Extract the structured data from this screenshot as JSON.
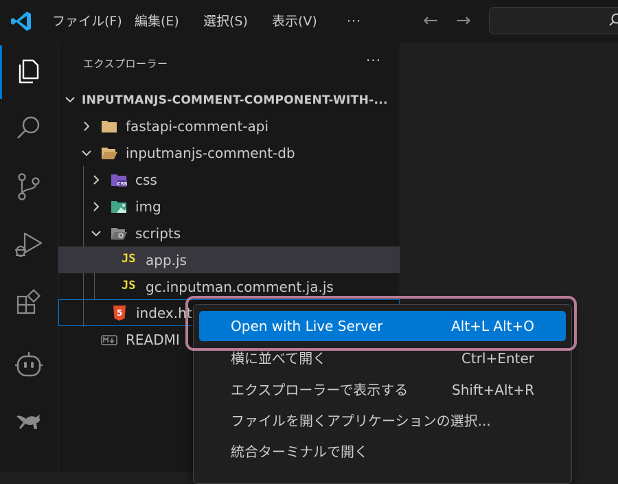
{
  "titlebar": {
    "menus": [
      "ファイル(F)",
      "編集(E)",
      "選択(S)",
      "表示(V)"
    ],
    "overflow": "···",
    "back": "←",
    "forward": "→",
    "search_placeholder": ""
  },
  "activity": {
    "icons": [
      "explorer-icon",
      "search-icon",
      "source-control-icon",
      "run-debug-icon",
      "extensions-icon",
      "copilot-icon",
      "kangaroo-icon"
    ]
  },
  "sidebar": {
    "title": "エクスプローラー",
    "more": "···",
    "root": "INPUTMANJS-COMMENT-COMPONENT-WITH-...",
    "items": [
      {
        "label": "fastapi-comment-api",
        "type": "folder",
        "expanded": false
      },
      {
        "label": "inputmanjs-comment-db",
        "type": "folder",
        "expanded": true
      },
      {
        "label": "css",
        "type": "folder-css",
        "expanded": false
      },
      {
        "label": "img",
        "type": "folder-img",
        "expanded": false
      },
      {
        "label": "scripts",
        "type": "folder-scripts",
        "expanded": true
      },
      {
        "label": "app.js",
        "type": "js",
        "badge": "JS"
      },
      {
        "label": "gc.inputman.comment.ja.js",
        "type": "js",
        "badge": "JS"
      },
      {
        "label": "index.ht",
        "type": "html"
      },
      {
        "label": "READMI",
        "type": "md"
      }
    ]
  },
  "context_menu": {
    "items": [
      {
        "label": "Open with Live Server",
        "shortcut": "Alt+L Alt+O"
      },
      {
        "label": "横に並べて開く",
        "shortcut": "Ctrl+Enter"
      },
      {
        "label": "エクスプローラーで表示する",
        "shortcut": "Shift+Alt+R"
      },
      {
        "label": "ファイルを開くアプリケーションの選択...",
        "shortcut": ""
      },
      {
        "label": "統合ターミナルで開く",
        "shortcut": ""
      }
    ]
  },
  "colors": {
    "accent": "#0078d4",
    "highlight_frame": "#b77b96",
    "folder": "#dcb67a",
    "js": "#f1dd35",
    "html": "#e44d26"
  }
}
